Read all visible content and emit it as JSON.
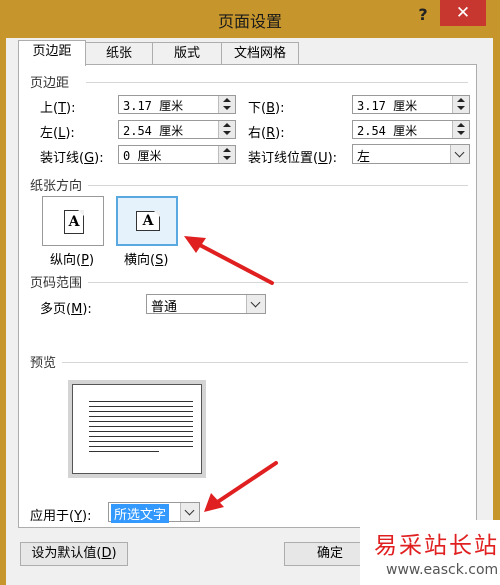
{
  "window": {
    "title": "页面设置",
    "help_label": "?",
    "close_label": "✕"
  },
  "tabs": [
    {
      "label": "页边距",
      "active": true
    },
    {
      "label": "纸张",
      "active": false
    },
    {
      "label": "版式",
      "active": false
    },
    {
      "label": "文档网格",
      "active": false
    }
  ],
  "margins": {
    "section_title": "页边距",
    "top": {
      "label": "上",
      "key": "T",
      "value": "3.17 厘米"
    },
    "bottom": {
      "label": "下",
      "key": "B",
      "value": "3.17 厘米"
    },
    "left": {
      "label": "左",
      "key": "L",
      "value": "2.54 厘米"
    },
    "right": {
      "label": "右",
      "key": "R",
      "value": "2.54 厘米"
    },
    "gutter": {
      "label": "装订线",
      "key": "G",
      "value": "0 厘米"
    },
    "gutter_position": {
      "label": "装订线位置",
      "key": "U",
      "value": "左"
    }
  },
  "orientation": {
    "section_title": "纸张方向",
    "portrait": {
      "label": "纵向",
      "key": "P",
      "icon": "A"
    },
    "landscape": {
      "label": "横向",
      "key": "S",
      "icon": "A",
      "selected": true
    }
  },
  "pages": {
    "section_title": "页码范围",
    "multiple": {
      "label": "多页",
      "key": "M",
      "value": "普通"
    }
  },
  "preview": {
    "section_title": "预览"
  },
  "apply_to": {
    "label": "应用于",
    "key": "Y",
    "value": "所选文字"
  },
  "buttons": {
    "set_default": {
      "label": "设为默认值",
      "key": "D"
    },
    "ok": "确定"
  },
  "watermark": {
    "text": "易采站长站",
    "url": "www.easck.com"
  },
  "colors": {
    "accent_red": "#e02020",
    "titlebar": "#c6962d",
    "close": "#c7372f",
    "selection": "#3399ff"
  }
}
